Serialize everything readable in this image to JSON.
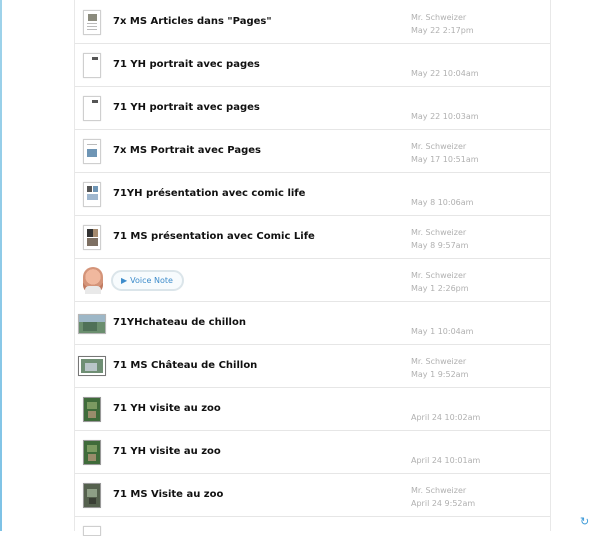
{
  "feed": {
    "items": [
      {
        "title": "7x MS Articles dans \"Pages\"",
        "author": "Mr. Schweizer",
        "date": "May 22 2:17pm",
        "thumb": "doc-image-icon"
      },
      {
        "title": "71 YH portrait avec pages",
        "author": "",
        "date": "May 22 10:04am",
        "thumb": "doc-icon"
      },
      {
        "title": "71 YH portrait avec pages",
        "author": "",
        "date": "May 22 10:03am",
        "thumb": "doc-icon"
      },
      {
        "title": "7x MS Portrait avec Pages",
        "author": "Mr. Schweizer",
        "date": "May 17 10:51am",
        "thumb": "doc-image-icon"
      },
      {
        "title": "71YH présentation avec comic life",
        "author": "",
        "date": "May 8 10:06am",
        "thumb": "comic-doc-icon"
      },
      {
        "title": "71 MS présentation avec Comic Life",
        "author": "Mr. Schweizer",
        "date": "May 8 9:57am",
        "thumb": "comic-doc-icon"
      },
      {
        "title": "",
        "author": "Mr. Schweizer",
        "date": "May 1 2:26pm",
        "thumb": "avatar",
        "voice_note_label": "Voice Note"
      },
      {
        "title": "71YHchateau de chillon",
        "author": "",
        "date": "May 1 10:04am",
        "thumb": "landscape-photo-icon"
      },
      {
        "title": "71 MS Château de Chillon",
        "author": "Mr. Schweizer",
        "date": "May 1 9:52am",
        "thumb": "landscape-photo-icon"
      },
      {
        "title": "71 YH visite au zoo",
        "author": "",
        "date": "April 24 10:02am",
        "thumb": "photo-icon"
      },
      {
        "title": "71 YH visite au zoo",
        "author": "",
        "date": "April 24 10:01am",
        "thumb": "photo-icon"
      },
      {
        "title": "71 MS Visite au zoo",
        "author": "Mr. Schweizer",
        "date": "April 24 9:52am",
        "thumb": "photo-icon"
      }
    ]
  },
  "icons": {
    "refresh": "refresh-icon",
    "play": "play-icon"
  },
  "colors": {
    "accent": "#3c9ad8",
    "meta_text": "#b0b0b0",
    "title_text": "#111111"
  }
}
